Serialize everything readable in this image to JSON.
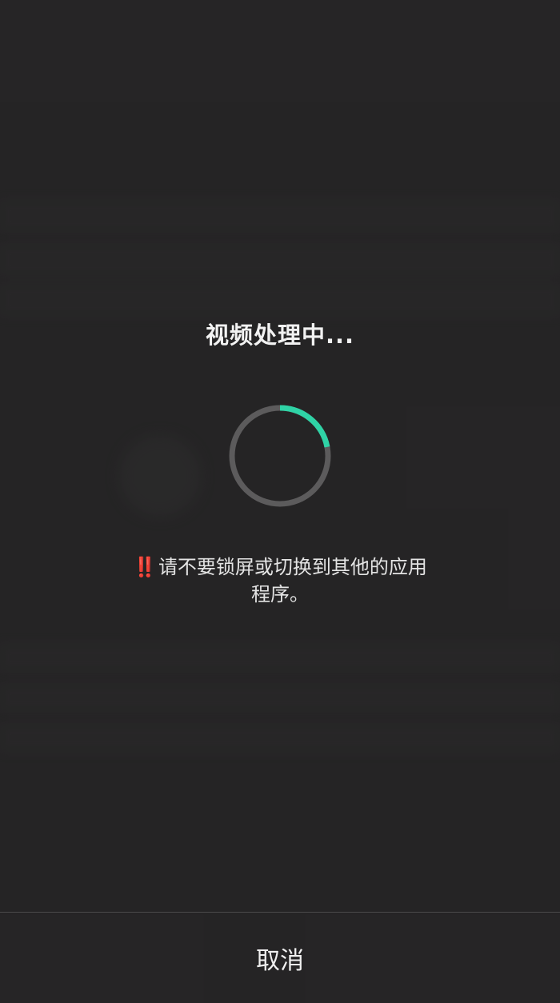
{
  "dialog": {
    "title": "视频处理中...",
    "progress_fraction": 0.22,
    "warning_icon": "double-exclamation-icon",
    "warning_mark": "‼️",
    "warning_text": "请不要锁屏或切换到其他的应用程序。",
    "cancel_label": "取消"
  },
  "colors": {
    "background": "#2a292a",
    "ring_track": "#5c5b5c",
    "ring_progress": "#2fd3a6",
    "warning_red": "#e0362c",
    "text": "#f2f2f2"
  }
}
